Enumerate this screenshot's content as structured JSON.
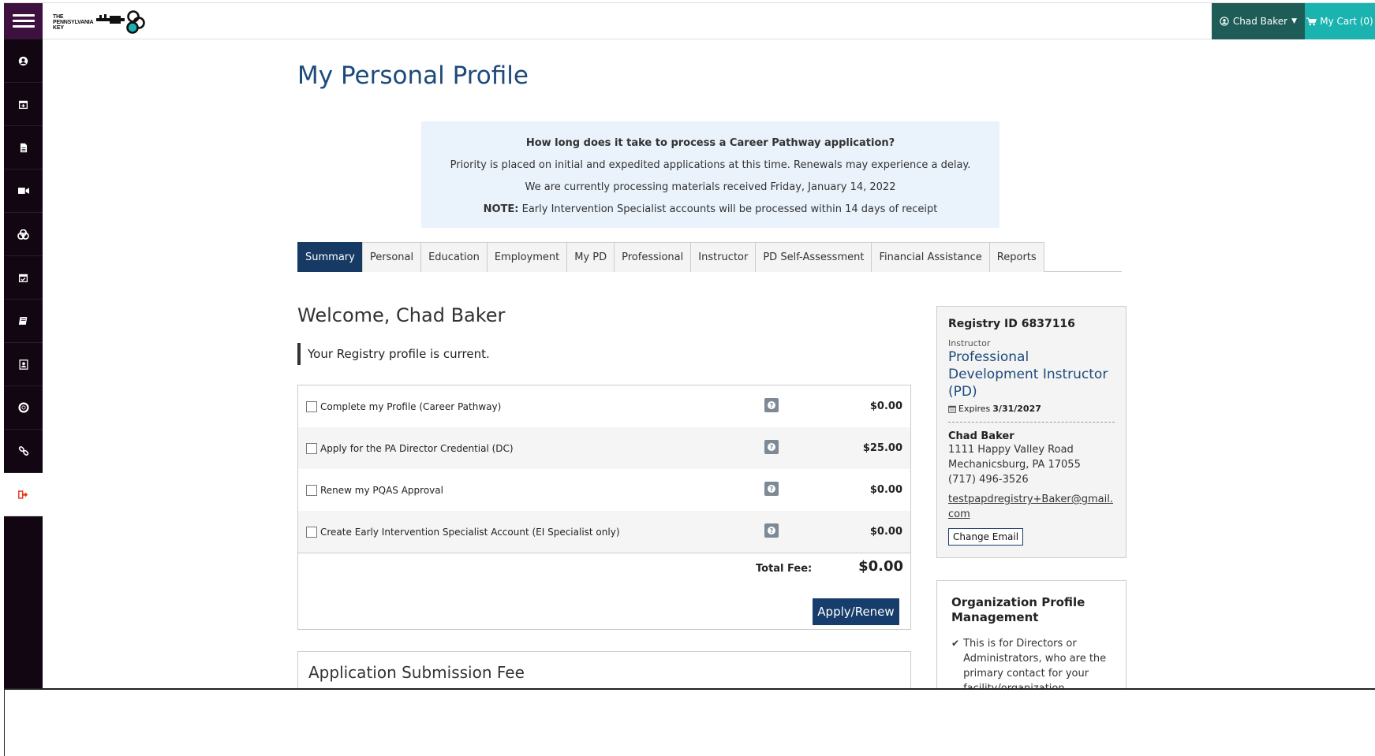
{
  "topbar": {
    "logo_text": [
      "THE",
      "PENNSYLVANIA",
      "KEY"
    ],
    "user_label": "Chad Baker",
    "cart_label": "My Cart (0)"
  },
  "sidebar": {
    "items": [
      "menu-icon",
      "user-icon",
      "calendar-plus-icon",
      "document-icon",
      "video-icon",
      "coins-icon",
      "calendar-check-icon",
      "book-icon",
      "id-card-icon",
      "lifebuoy-icon",
      "link-icon",
      "sign-out-icon"
    ]
  },
  "page": {
    "title": "My Personal Profile"
  },
  "notice": {
    "question": "How long does it take to process a Career Pathway application?",
    "line1": "Priority is placed on initial and expedited applications at this time. Renewals may experience a delay.",
    "line2": "We are currently processing materials received Friday, January 14, 2022",
    "note_label": "NOTE:",
    "note_text": " Early Intervention Specialist accounts will be processed within 14 days of receipt"
  },
  "tabs": [
    "Summary",
    "Personal",
    "Education",
    "Employment",
    "My PD",
    "Professional",
    "Instructor",
    "PD Self-Assessment",
    "Financial Assistance",
    "Reports"
  ],
  "summary": {
    "welcome": "Welcome, Chad Baker",
    "status": "Your Registry profile is current.",
    "items": [
      {
        "label": "Complete my Profile (Career Pathway)",
        "price": "$0.00"
      },
      {
        "label": "Apply for the PA Director Credential (DC)",
        "price": "$25.00"
      },
      {
        "label": "Renew my PQAS Approval",
        "price": "$0.00"
      },
      {
        "label": "Create Early Intervention Specialist Account (EI Specialist only)",
        "price": "$0.00"
      }
    ],
    "total_label": "Total Fee:",
    "total_value": "$0.00",
    "apply_button": "Apply/Renew",
    "fee_section_title": "Application Submission Fee"
  },
  "registry": {
    "id_label": "Registry ID 6837116",
    "role_small": "Instructor",
    "role_title": "Professional Development Instructor (PD)",
    "expires_label": "Expires",
    "expires_date": "3/31/2027",
    "name": "Chad Baker",
    "address1": "1111 Happy Valley Road",
    "address2": "Mechanicsburg, PA 17055",
    "phone": "(717) 496-3526",
    "email": "testpapdregistry+Baker@gmail.com",
    "change_email": "Change Email"
  },
  "org": {
    "title": "Organization Profile Management",
    "item1": "This is for Directors or Administrators, who are the primary contact for your facility/organization"
  },
  "colors": {
    "sidebar_bg": "#120612",
    "menu_bg": "#3d1040",
    "user_btn": "#1d5c57",
    "cart_btn": "#1ab3b0",
    "primary": "#163d6b",
    "title": "#1c4a7a",
    "notice_bg": "#eaf2fb"
  }
}
